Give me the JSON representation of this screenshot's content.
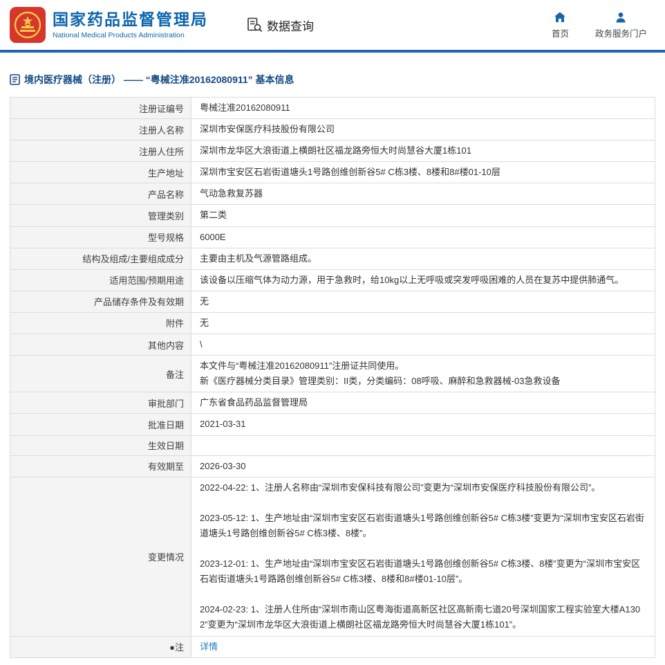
{
  "header": {
    "org_name": "国家药品监督管理局",
    "org_name_en": "National Medical Products Administration",
    "nav_data_query": "数据查询",
    "nav_home": "首页",
    "nav_portal": "政务服务门户"
  },
  "icons": {
    "logo": "china-national-emblem",
    "data_query": "document-with-magnifier",
    "home": "house",
    "portal": "person",
    "page_title": "document"
  },
  "page": {
    "title": "境内医疗器械（注册） ——  “粤械注准20162080911”  基本信息"
  },
  "table": {
    "rows": [
      {
        "label": "注册证编号",
        "value": "粤械注准20162080911"
      },
      {
        "label": "注册人名称",
        "value": "深圳市安保医疗科技股份有限公司"
      },
      {
        "label": "注册人住所",
        "value": "深圳市龙华区大浪街道上横朗社区福龙路旁恒大时尚慧谷大厦1栋101"
      },
      {
        "label": "生产地址",
        "value": "深圳市宝安区石岩街道塘头1号路创维创新谷5# C栋3楼、8楼和8#楼01-10层"
      },
      {
        "label": "产品名称",
        "value": "气动急救复苏器"
      },
      {
        "label": "管理类别",
        "value": "第二类"
      },
      {
        "label": "型号规格",
        "value": "6000E"
      },
      {
        "label": "结构及组成/主要组成成分",
        "value": "主要由主机及气源管路组成。"
      },
      {
        "label": "适用范围/预期用途",
        "value": "该设备以压缩气体为动力源，用于急救时，给10kg以上无呼吸或突发呼吸困难的人员在复苏中提供肺通气。"
      },
      {
        "label": "产品储存条件及有效期",
        "value": "无"
      },
      {
        "label": "附件",
        "value": "无"
      },
      {
        "label": "其他内容",
        "value": "\\"
      },
      {
        "label": "备注",
        "value": "本文件与“粤械注准20162080911”注册证共同使用。\n新《医疗器械分类目录》管理类别：II类，分类编码：08呼吸、麻醉和急救器械-03急救设备"
      },
      {
        "label": "审批部门",
        "value": "广东省食品药品监督管理局"
      },
      {
        "label": "批准日期",
        "value": "2021-03-31"
      },
      {
        "label": "生效日期",
        "value": ""
      },
      {
        "label": "有效期至",
        "value": "2026-03-30"
      },
      {
        "label": "变更情况",
        "value": "2022-04-22: 1、注册人名称由“深圳市安保科技有限公司”变更为“深圳市安保医疗科技股份有限公司”。\n\n2023-05-12: 1、生产地址由“深圳市宝安区石岩街道塘头1号路创维创新谷5# C栋3楼”变更为“深圳市宝安区石岩街道塘头1号路创维创新谷5# C栋3楼、8楼”。\n\n2023-12-01: 1、生产地址由“深圳市宝安区石岩街道塘头1号路创维创新谷5# C栋3楼、8楼”变更为“深圳市宝安区石岩街道塘头1号路路创维创新谷5# C栋3楼、8楼和8#楼01-10层”。\n\n2024-02-23: 1、注册人住所由“深圳市南山区粤海街道高新区社区高新南七道20号深圳国家工程实验室大楼A1302”变更为“深圳市龙华区大浪街道上横朗社区福龙路旁恒大时尚慧谷大厦1栋101”。"
      },
      {
        "label": "●注",
        "value": "详情",
        "link": true
      }
    ]
  },
  "colors": {
    "brand_blue": "#0d65ad",
    "divider_blue": "#1c64ad",
    "title_navy": "#134a84",
    "link_blue": "#1b7ec2",
    "label_bg": "#f4f4f4",
    "logo_red": "#d6362b",
    "logo_gold": "#f7c948"
  }
}
